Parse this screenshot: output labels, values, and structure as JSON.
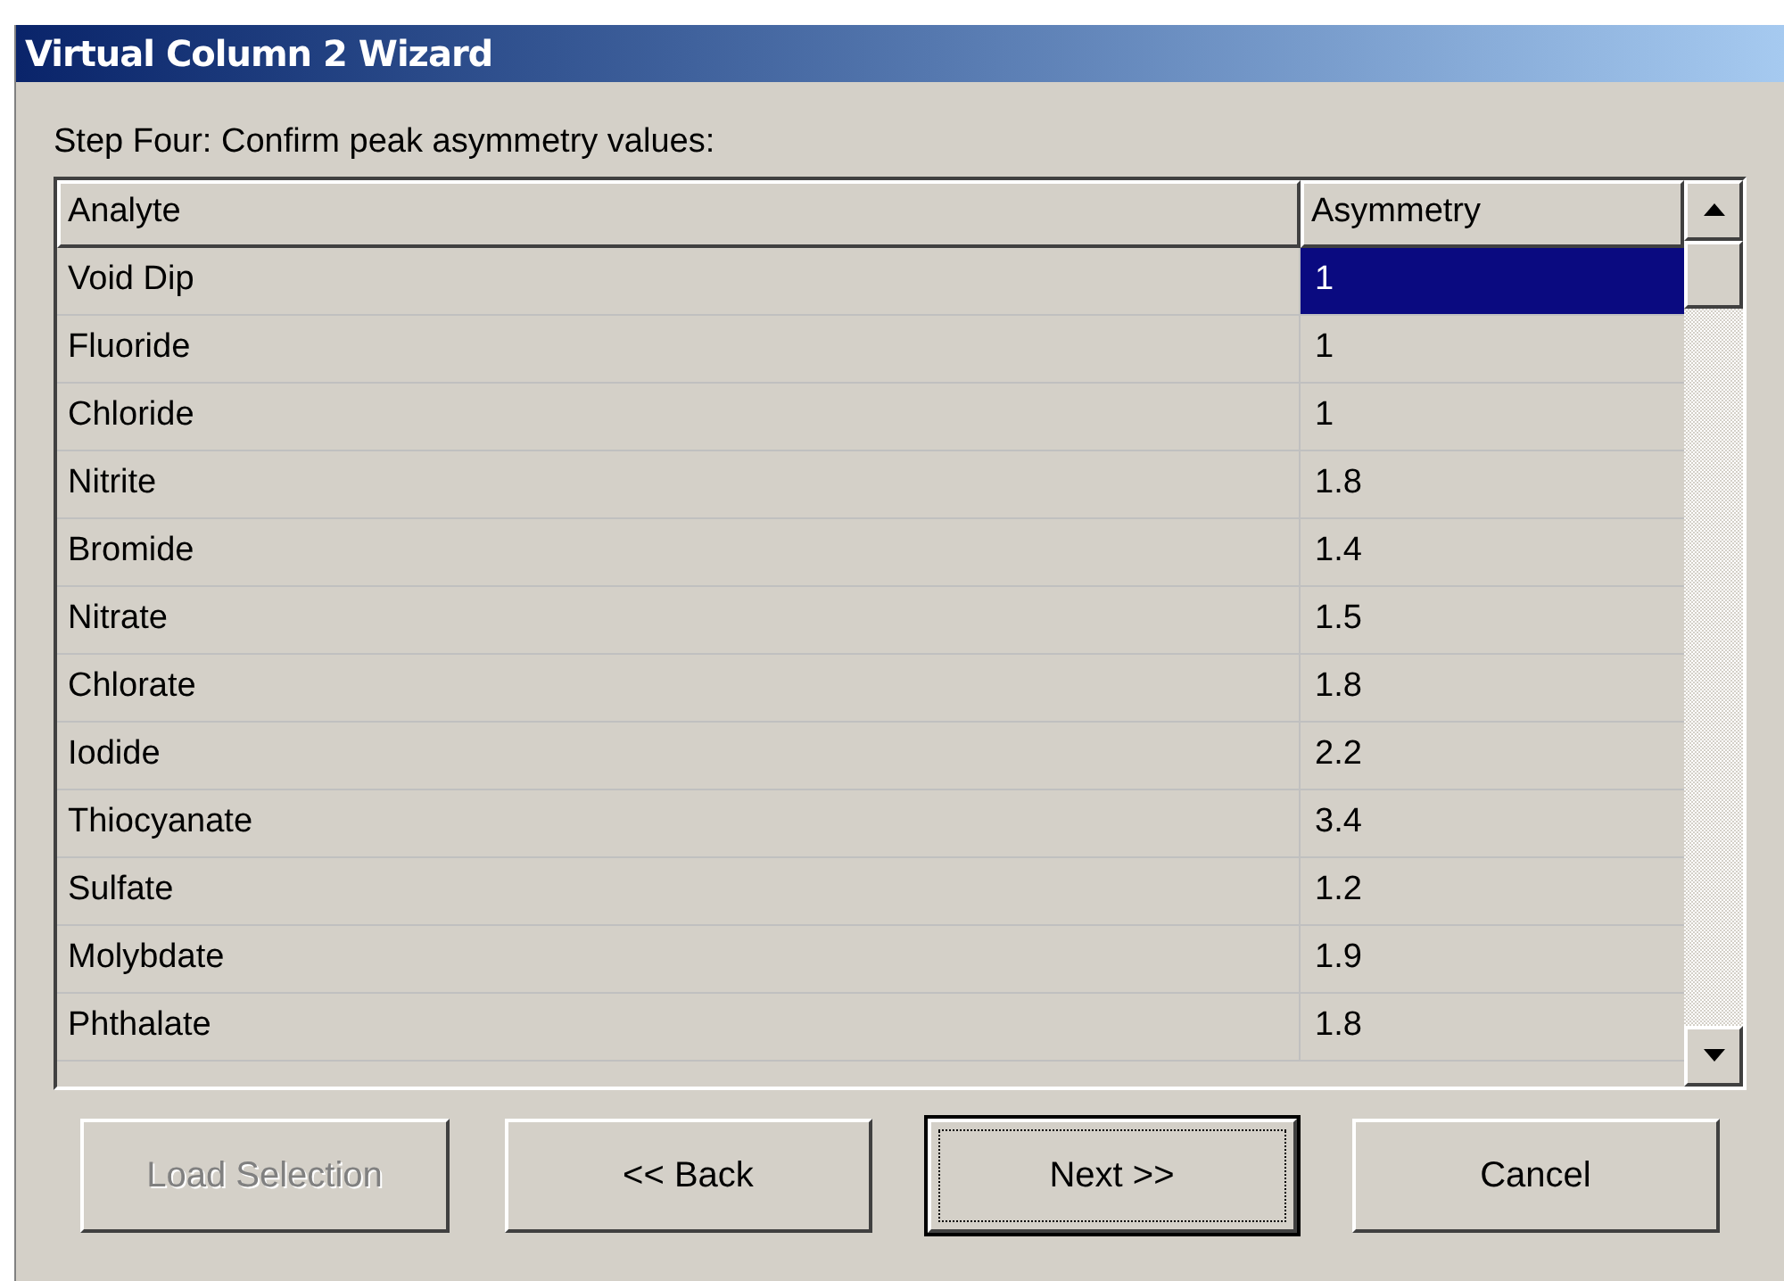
{
  "window": {
    "title": "Virtual Column 2 Wizard"
  },
  "instruction": "Step Four: Confirm peak asymmetry values:",
  "table": {
    "columns": [
      "Analyte",
      "Asymmetry"
    ],
    "rows": [
      {
        "analyte": "Void Dip",
        "asymmetry": "1",
        "selected": true
      },
      {
        "analyte": "Fluoride",
        "asymmetry": "1",
        "selected": false
      },
      {
        "analyte": "Chloride",
        "asymmetry": "1",
        "selected": false
      },
      {
        "analyte": "Nitrite",
        "asymmetry": "1.8",
        "selected": false
      },
      {
        "analyte": "Bromide",
        "asymmetry": "1.4",
        "selected": false
      },
      {
        "analyte": "Nitrate",
        "asymmetry": "1.5",
        "selected": false
      },
      {
        "analyte": "Chlorate",
        "asymmetry": "1.8",
        "selected": false
      },
      {
        "analyte": "Iodide",
        "asymmetry": "2.2",
        "selected": false
      },
      {
        "analyte": "Thiocyanate",
        "asymmetry": "3.4",
        "selected": false
      },
      {
        "analyte": "Sulfate",
        "asymmetry": "1.2",
        "selected": false
      },
      {
        "analyte": "Molybdate",
        "asymmetry": "1.9",
        "selected": false
      },
      {
        "analyte": "Phthalate",
        "asymmetry": "1.8",
        "selected": false
      }
    ]
  },
  "buttons": [
    {
      "label": "Load Selection",
      "disabled": true,
      "focused": false
    },
    {
      "label": "<< Back",
      "disabled": false,
      "focused": false
    },
    {
      "label": "Next >>",
      "disabled": false,
      "focused": true
    },
    {
      "label": "Cancel",
      "disabled": false,
      "focused": false
    }
  ]
}
